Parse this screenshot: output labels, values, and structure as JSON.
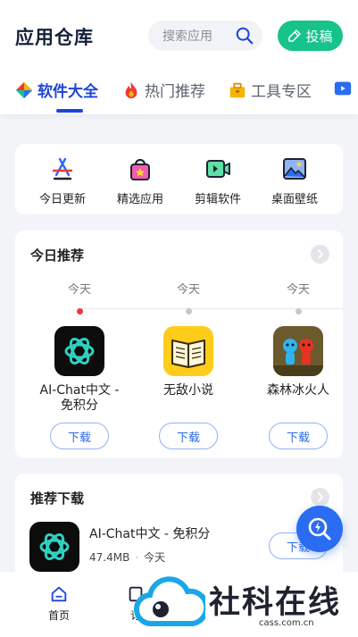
{
  "header": {
    "title": "应用仓库",
    "search_placeholder": "搜索应用",
    "post_label": "投稿"
  },
  "tabs": [
    {
      "label": "软件大全",
      "icon": "software-colorful-icon",
      "active": true
    },
    {
      "label": "热门推荐",
      "icon": "fire-icon",
      "active": false
    },
    {
      "label": "工具专区",
      "icon": "toolbox-icon",
      "active": false
    },
    {
      "label": "",
      "icon": "video-tab-icon",
      "active": false
    }
  ],
  "quick_links": [
    {
      "label": "今日更新",
      "icon": "app-store-icon"
    },
    {
      "label": "精选应用",
      "icon": "shopping-bag-icon"
    },
    {
      "label": "剪辑软件",
      "icon": "video-edit-icon"
    },
    {
      "label": "桌面壁纸",
      "icon": "image-icon"
    }
  ],
  "today": {
    "title": "今日推荐",
    "apps": [
      {
        "day": "今天",
        "name": "AI-Chat中文 - 免积分",
        "button": "下载",
        "icon": "ai-chat-app-icon"
      },
      {
        "day": "今天",
        "name": "无敌小说",
        "button": "下载",
        "icon": "novel-book-app-icon"
      },
      {
        "day": "今天",
        "name": "森林冰火人",
        "button": "下载",
        "icon": "fireboy-watergirl-app-icon"
      }
    ]
  },
  "recommend": {
    "title": "推荐下载",
    "items": [
      {
        "name": "AI-Chat中文 - 免积分",
        "size": "47.4MB",
        "date": "今天",
        "button": "下载"
      }
    ]
  },
  "bottom_nav": [
    {
      "label": "首页",
      "icon": "home-icon"
    },
    {
      "label": "订",
      "icon": "subscribe-icon"
    }
  ],
  "watermark": {
    "text": "社科在线",
    "sub": "cass.com.cn"
  },
  "colors": {
    "accent": "#1e44d8",
    "post": "#16c38b",
    "download": "#2d6be6",
    "fab": "#2a6cf2"
  }
}
